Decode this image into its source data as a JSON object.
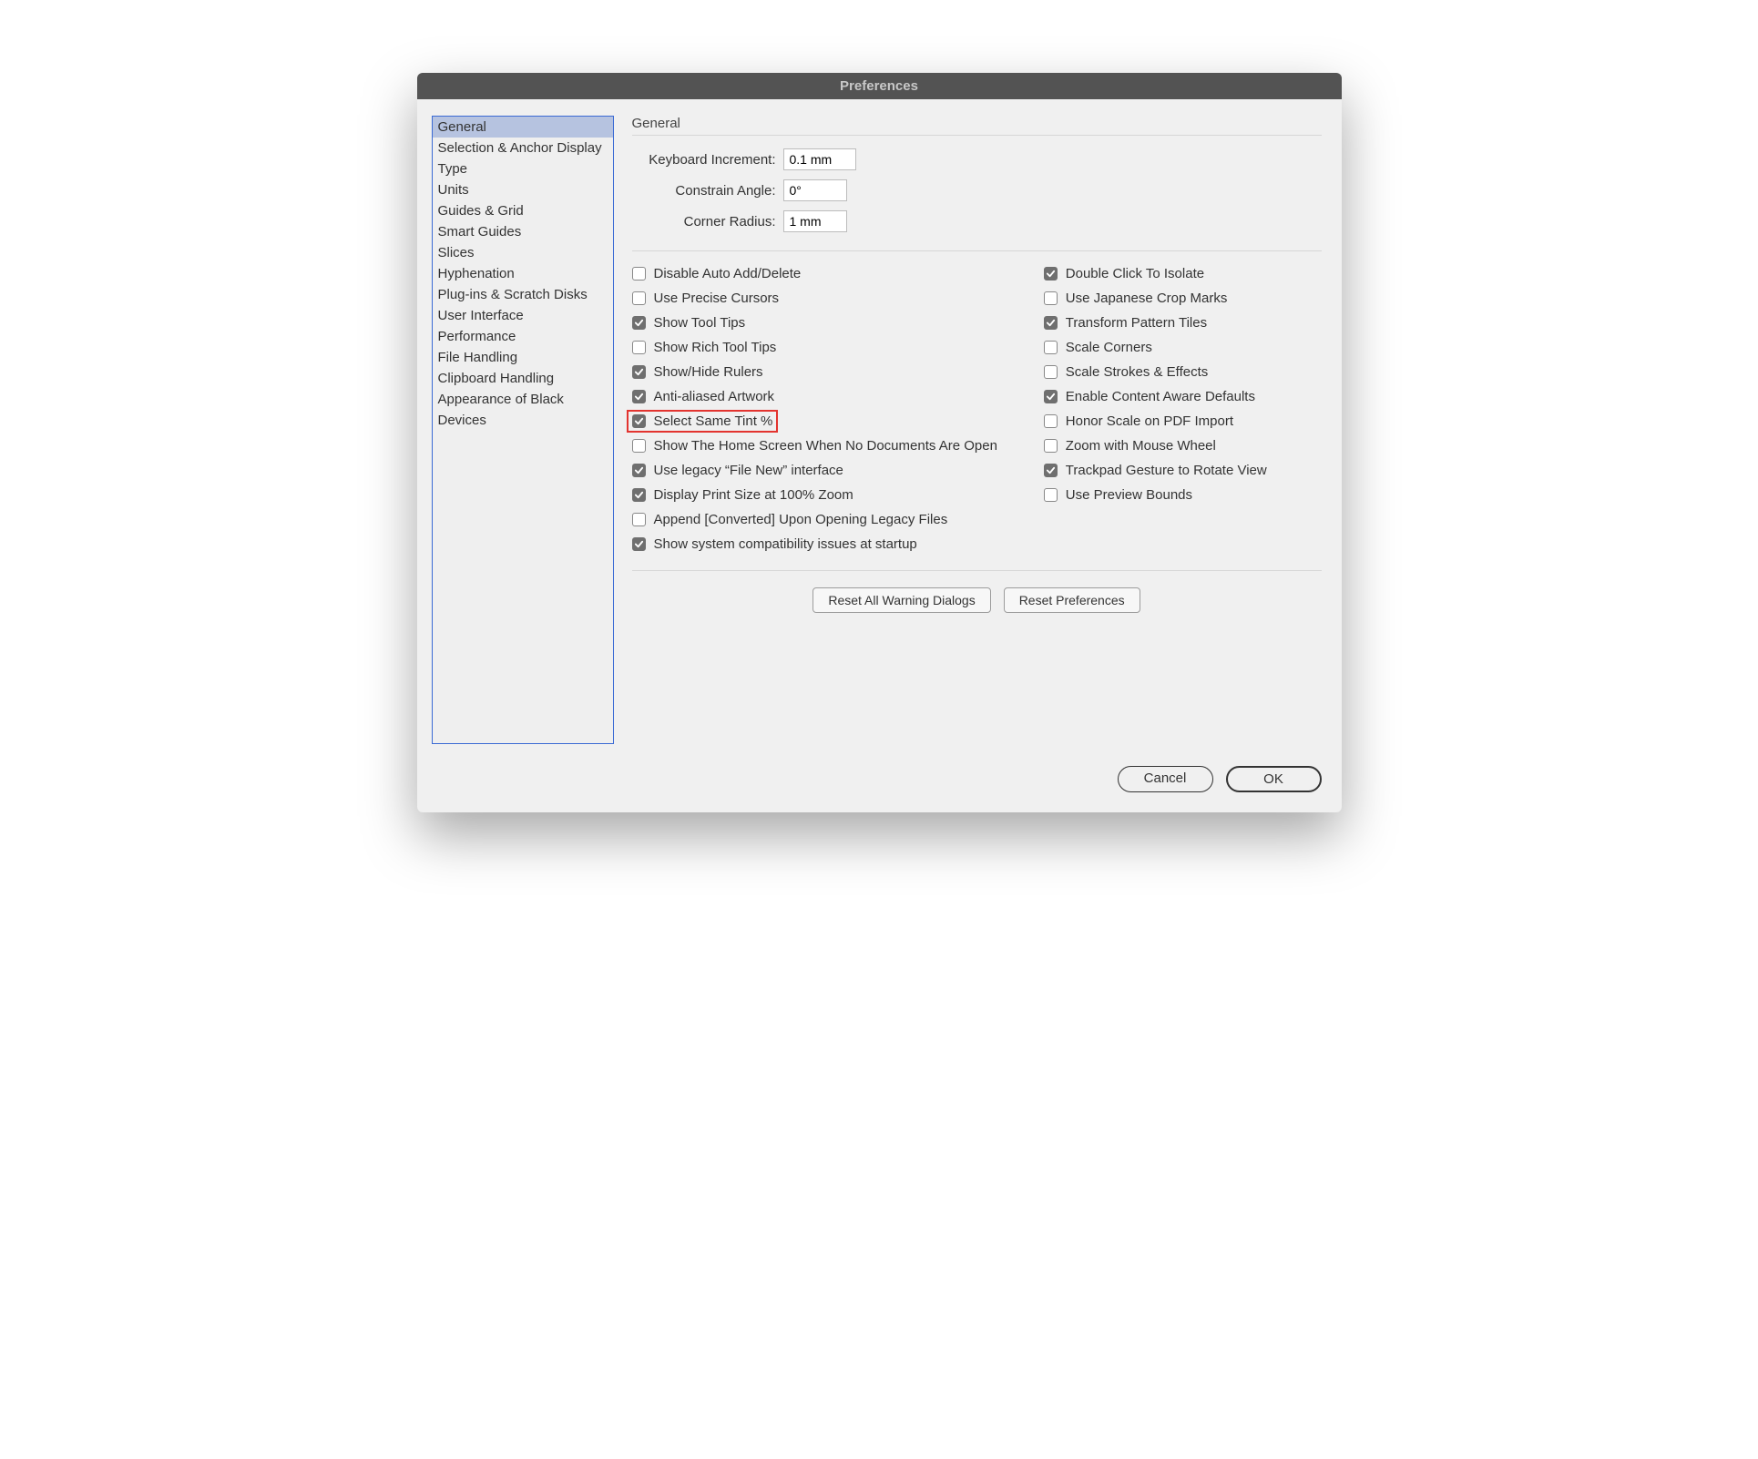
{
  "title": "Preferences",
  "sidebar": {
    "items": [
      "General",
      "Selection & Anchor Display",
      "Type",
      "Units",
      "Guides & Grid",
      "Smart Guides",
      "Slices",
      "Hyphenation",
      "Plug-ins & Scratch Disks",
      "User Interface",
      "Performance",
      "File Handling",
      "Clipboard Handling",
      "Appearance of Black",
      "Devices"
    ],
    "selected_index": 0
  },
  "section": {
    "heading": "General",
    "fields": {
      "keyboard_increment": {
        "label": "Keyboard Increment:",
        "value": "0.1 mm"
      },
      "constrain_angle": {
        "label": "Constrain Angle:",
        "value": "0°"
      },
      "corner_radius": {
        "label": "Corner Radius:",
        "value": "1 mm"
      }
    },
    "checkbox_left": [
      {
        "label": "Disable Auto Add/Delete",
        "checked": false
      },
      {
        "label": "Use Precise Cursors",
        "checked": false
      },
      {
        "label": "Show Tool Tips",
        "checked": true
      },
      {
        "label": "Show Rich Tool Tips",
        "checked": false
      },
      {
        "label": "Show/Hide Rulers",
        "checked": true
      },
      {
        "label": "Anti-aliased Artwork",
        "checked": true
      },
      {
        "label": "Select Same Tint %",
        "checked": true,
        "highlight": true
      },
      {
        "label": "Show The Home Screen When No Documents Are Open",
        "checked": false
      },
      {
        "label": "Use legacy “File New” interface",
        "checked": true
      },
      {
        "label": "Display Print Size at 100% Zoom",
        "checked": true
      },
      {
        "label": "Append [Converted] Upon Opening Legacy Files",
        "checked": false
      },
      {
        "label": "Show system compatibility issues at startup",
        "checked": true
      }
    ],
    "checkbox_right": [
      {
        "label": "Double Click To Isolate",
        "checked": true
      },
      {
        "label": "Use Japanese Crop Marks",
        "checked": false
      },
      {
        "label": "Transform Pattern Tiles",
        "checked": true
      },
      {
        "label": "Scale Corners",
        "checked": false
      },
      {
        "label": "Scale Strokes & Effects",
        "checked": false
      },
      {
        "label": "Enable Content Aware Defaults",
        "checked": true
      },
      {
        "label": "Honor Scale on PDF Import",
        "checked": false
      },
      {
        "label": "Zoom with Mouse Wheel",
        "checked": false
      },
      {
        "label": "Trackpad Gesture to Rotate View",
        "checked": true
      },
      {
        "label": "Use Preview Bounds",
        "checked": false
      }
    ],
    "reset_buttons": {
      "reset_dialogs": "Reset All Warning Dialogs",
      "reset_prefs": "Reset Preferences"
    }
  },
  "footer": {
    "cancel": "Cancel",
    "ok": "OK"
  }
}
